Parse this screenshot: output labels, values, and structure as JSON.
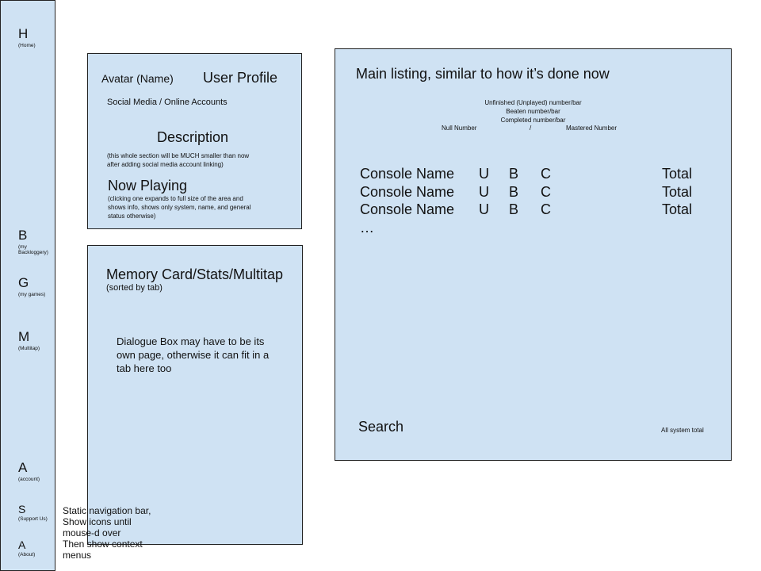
{
  "nav": {
    "items": [
      {
        "letter": "H",
        "sub": "(Home)"
      },
      {
        "letter": "B",
        "sub": "(my Backloggery)"
      },
      {
        "letter": "G",
        "sub": "(my games)"
      },
      {
        "letter": "M",
        "sub": "(Multitap)"
      },
      {
        "letter": "A",
        "sub": "(account)"
      },
      {
        "letter": "S",
        "sub": "(Support Us)"
      },
      {
        "letter": "A",
        "sub": "(About)"
      }
    ],
    "note": [
      "Static navigation bar,",
      "Show icons until",
      "mouse-d over",
      "Then show context",
      "menus"
    ]
  },
  "profile": {
    "avatar": "Avatar (Name)",
    "title": "User Profile",
    "social": "Social Media / Online Accounts",
    "description": "Description",
    "description_note": [
      "(this whole section will be MUCH smaller than now",
      "after adding social media account linking)"
    ],
    "now_playing": "Now Playing",
    "now_playing_note": [
      "(clicking one expands to full size of the area and",
      "shows info, shows only system, name, and general",
      "status otherwise)"
    ]
  },
  "memory": {
    "title": "Memory Card/Stats/Multitap",
    "subtitle": "(sorted by tab)",
    "dialogue": [
      "Dialogue Box may have to be its",
      "own page, otherwise it can fit in a",
      "tab here too"
    ]
  },
  "main": {
    "title": "Main listing, similar to how it’s done now",
    "stats": [
      "Unfinished (Unplayed) number/bar",
      "Beaten number/bar",
      "Completed number/bar"
    ],
    "null_number": "Null Number",
    "slash": "/",
    "mastered_number": "Mastered Number",
    "rows": [
      {
        "console": "Console Name",
        "u": "U",
        "b": "B",
        "c": "C",
        "total": "Total"
      },
      {
        "console": "Console Name",
        "u": "U",
        "b": "B",
        "c": "C",
        "total": "Total"
      },
      {
        "console": "Console Name",
        "u": "U",
        "b": "B",
        "c": "C",
        "total": "Total"
      }
    ],
    "ellipsis": "…",
    "search": "Search",
    "all_total": "All system total"
  }
}
